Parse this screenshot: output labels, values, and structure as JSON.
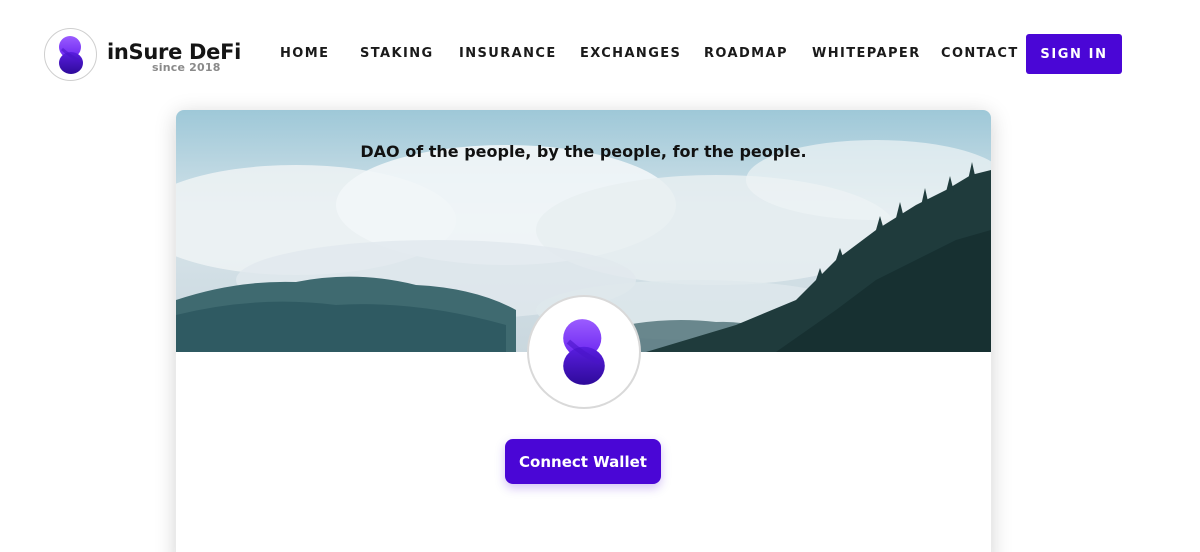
{
  "brand": {
    "name": "inSure DeFi",
    "tagline": "since 2018",
    "logo_icon": "insure-s-logo-icon"
  },
  "nav": {
    "items": [
      {
        "label": "HOME"
      },
      {
        "label": "STAKING"
      },
      {
        "label": "INSURANCE"
      },
      {
        "label": "EXCHANGES"
      },
      {
        "label": "ROADMAP"
      },
      {
        "label": "WHITEPAPER"
      },
      {
        "label": "CONTACT"
      }
    ],
    "sign_in_label": "SIGN IN"
  },
  "card": {
    "tagline": "DAO of the people, by the people, for the people.",
    "connect_label": "Connect Wallet"
  },
  "colors": {
    "accent": "#4a06d6",
    "logo_light": "#8b4dff",
    "logo_dark": "#3a0fb0"
  }
}
